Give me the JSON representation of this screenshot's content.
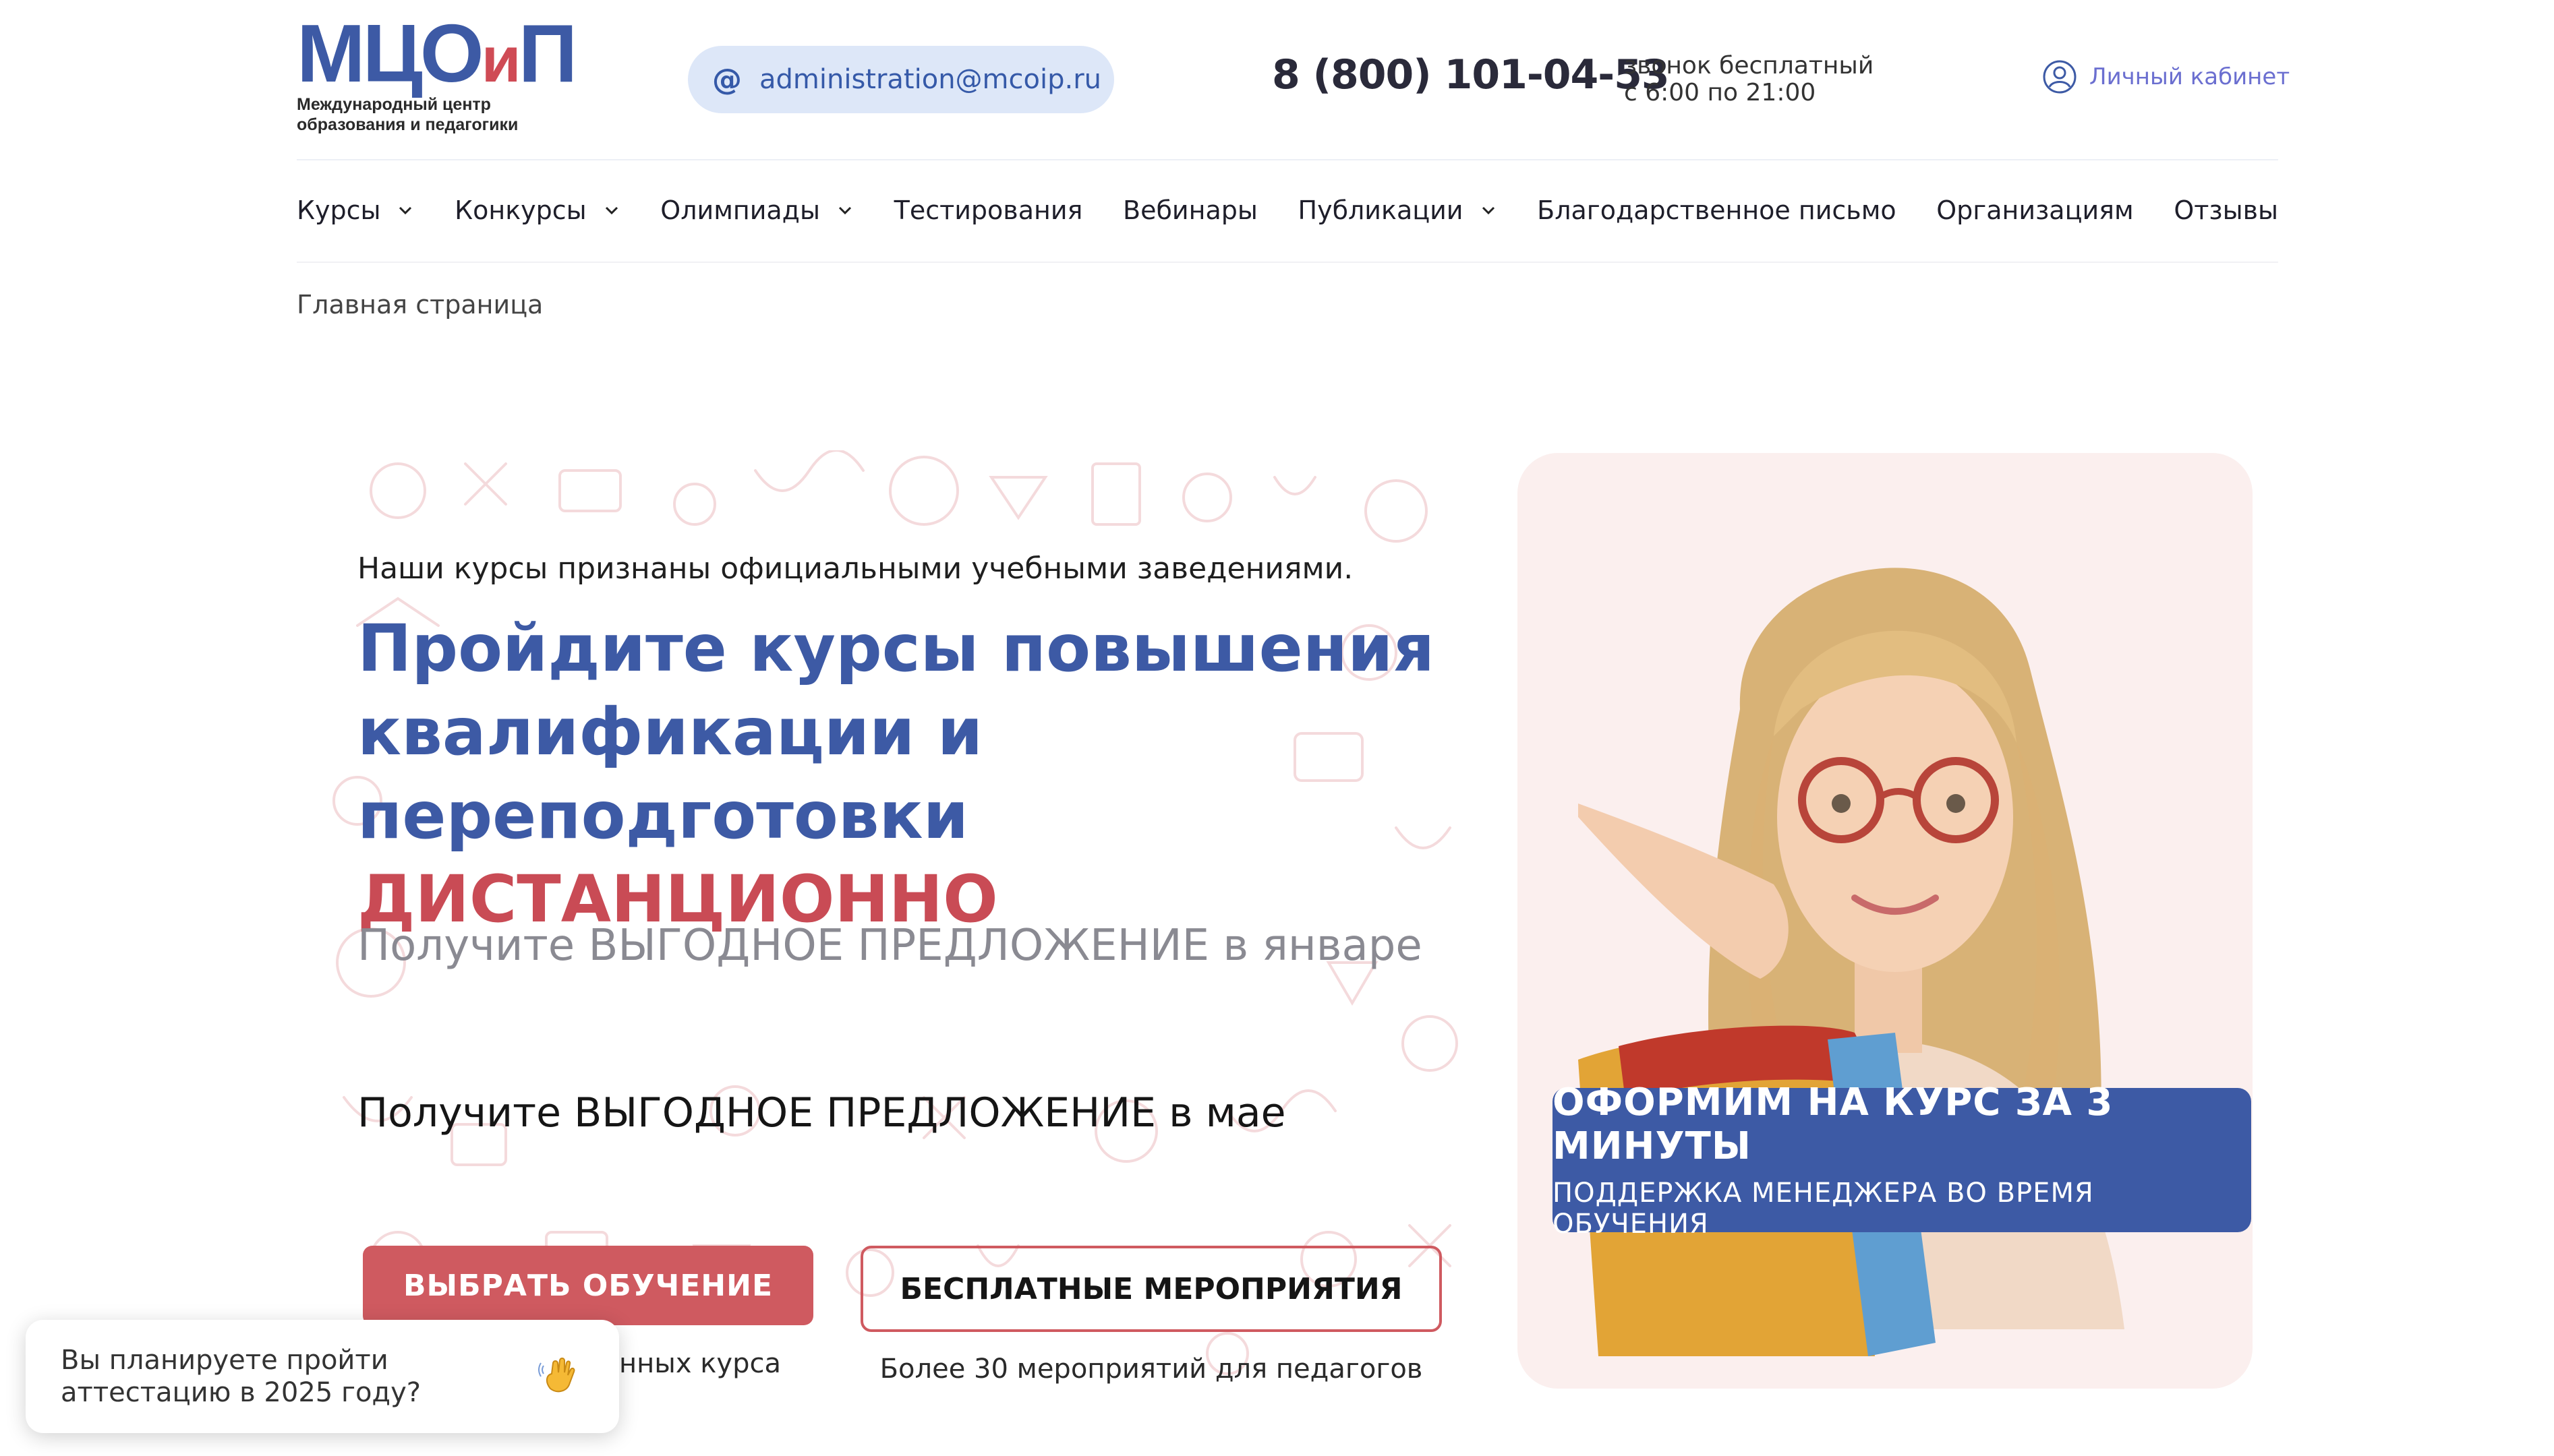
{
  "header": {
    "logo": {
      "mark_parts": [
        "МЦО",
        "и",
        "П"
      ],
      "subtitle_lines": [
        "Международный центр",
        "образования и педагогики"
      ]
    },
    "email": "administration@mcoip.ru",
    "phone": "8 (800) 101-04-53",
    "phone_note_lines": [
      "звонок бесплатный",
      "с 6:00 по 21:00"
    ],
    "cabinet_label": "Личный кабинет"
  },
  "nav": {
    "items": [
      {
        "label": "Курсы",
        "has_dropdown": true
      },
      {
        "label": "Конкурсы",
        "has_dropdown": true
      },
      {
        "label": "Олимпиады",
        "has_dropdown": true
      },
      {
        "label": "Тестирования",
        "has_dropdown": false
      },
      {
        "label": "Вебинары",
        "has_dropdown": false
      },
      {
        "label": "Публикации",
        "has_dropdown": true
      },
      {
        "label": "Благодарственное письмо",
        "has_dropdown": false
      },
      {
        "label": "Организациям",
        "has_dropdown": false
      },
      {
        "label": "Отзывы",
        "has_dropdown": false
      }
    ]
  },
  "breadcrumb": "Главная страница",
  "hero": {
    "note": "Наши курсы признаны официальными учебными заведениями.",
    "title_lines": [
      "Пройдите курсы повышения",
      "квалификации и переподготовки"
    ],
    "title_accent": "ДИСТАНЦИОННО",
    "offer_faded": "Получите ВЫГОДНОЕ ПРЕДЛОЖЕНИЕ в январе",
    "offer": "Получите ВЫГОДНОЕ ПРЕДЛОЖЕНИЕ в мае",
    "primary_button": "ВЫБРАТЬ ОБУЧЕНИЕ",
    "primary_sub_visible": "анных курса",
    "secondary_button": "БЕСПЛАТНЫЕ МЕРОПРИЯТИЯ",
    "secondary_sub": "Более 30 мероприятий для педагогов"
  },
  "promo": {
    "line1": "ОФОРМИМ НА КУРС ЗА 3 МИНУТЫ",
    "line2": "ПОДДЕРЖКА МЕНЕДЖЕРА ВО ВРЕМЯ ОБУЧЕНИЯ"
  },
  "chat_popup": {
    "lines": [
      "Вы планируете пройти",
      "аттестацию в 2025 году?"
    ],
    "icon": "waving-hand-icon"
  },
  "colors": {
    "brand_blue": "#3d5aa5",
    "brand_red": "#cf5a60",
    "email_bg": "#dde7f8",
    "cabinet_text": "#6b6fd0",
    "photo_bg": "#fbefee"
  }
}
